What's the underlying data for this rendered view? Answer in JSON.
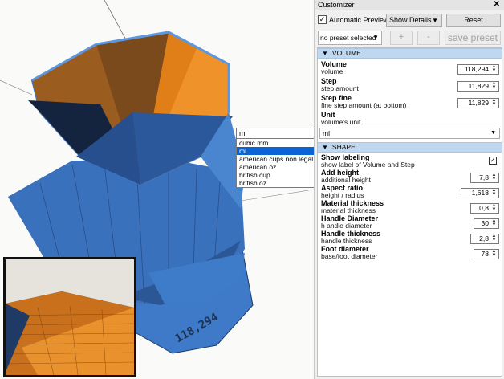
{
  "customizer": {
    "title": "Customizer",
    "close_icon": "close-icon",
    "automatic_preview_label": "Automatic Preview",
    "automatic_preview_checked": true,
    "show_details_label": "Show Details",
    "reset_label": "Reset",
    "preset_selected": "no preset selected",
    "add_preset_label": "+",
    "remove_preset_label": "-",
    "save_preset_label": "save preset"
  },
  "sections": {
    "volume": {
      "title": "VOLUME",
      "params": {
        "volume": {
          "name": "Volume",
          "desc": "volume",
          "value": "118,294"
        },
        "step": {
          "name": "Step",
          "desc": "step amount",
          "value": "11,829"
        },
        "step_fine": {
          "name": "Step fine",
          "desc": "fine step amount (at bottom)",
          "value": "11,829"
        },
        "unit": {
          "name": "Unit",
          "desc": "volume's unit",
          "value": "ml"
        }
      }
    },
    "shape": {
      "title": "SHAPE",
      "params": {
        "show_labeling": {
          "name": "Show labeling",
          "desc": "show label of Volume and Step",
          "checked": true
        },
        "add_height": {
          "name": "Add height",
          "desc": "additional height",
          "value": "7,8"
        },
        "aspect_ratio": {
          "name": "Aspect ratio",
          "desc": "height / radius",
          "value": "1,618"
        },
        "material_thickness": {
          "name": "Material thickness",
          "desc": "material thickness",
          "value": "0,8"
        },
        "handle_diameter": {
          "name": "Handle Diameter",
          "desc": "h andle diameter",
          "value": "30"
        },
        "handle_thickness": {
          "name": "Handle thickness",
          "desc": "handle thickness",
          "value": "2,8"
        },
        "foot_diameter": {
          "name": "Foot diameter",
          "desc": "base/foot diameter",
          "value": "78"
        }
      }
    }
  },
  "unit_popup": {
    "current": "ml",
    "options": [
      "cubic mm",
      "ml",
      "american cups non legal",
      "american oz",
      "british cup",
      "british oz"
    ],
    "selected_index": 1
  },
  "colors": {
    "model_blue": "#3f7ac8",
    "model_blue_dark": "#1e3a66",
    "model_orange": "#f0922a",
    "section_header": "#bfd8ef",
    "selection": "#0a64d6"
  }
}
